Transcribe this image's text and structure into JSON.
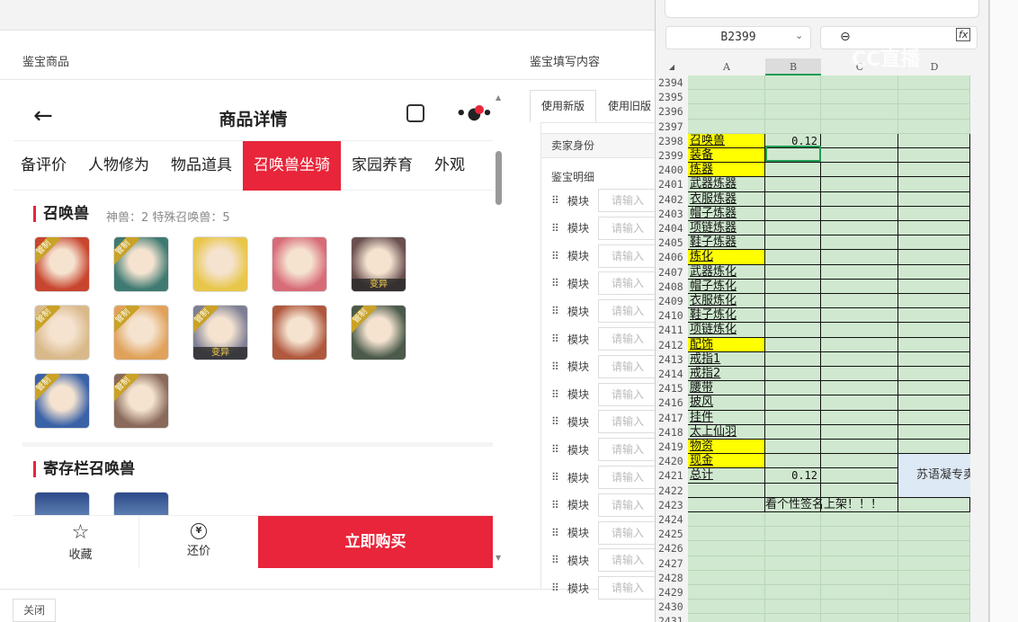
{
  "dialog": {
    "left_title": "鉴宝商品",
    "right_title": "鉴宝填写内容",
    "close_label": "关闭"
  },
  "phone": {
    "title": "商品详情",
    "tabs": [
      "备评价",
      "人物修为",
      "物品道具",
      "召唤兽坐骑",
      "家园养育",
      "外观"
    ],
    "active_tab": "召唤兽坐骑",
    "section1": {
      "title": "召唤兽",
      "subtitle": "神兽：2  特殊召唤兽：5"
    },
    "pets": [
      {
        "badge": "管制",
        "variant": "",
        "color": "#c8452f"
      },
      {
        "badge": "管制",
        "variant": "",
        "color": "#3f7a72"
      },
      {
        "badge": "",
        "variant": "",
        "color": "#e8c64a"
      },
      {
        "badge": "",
        "variant": "",
        "color": "#d86b78"
      },
      {
        "badge": "",
        "variant": "变异",
        "color": "#6a5050"
      },
      {
        "badge": "管制",
        "variant": "",
        "color": "#d9b98a"
      },
      {
        "badge": "管制",
        "variant": "",
        "color": "#e0a25a"
      },
      {
        "badge": "管制",
        "variant": "变异",
        "color": "#7d7f95"
      },
      {
        "badge": "",
        "variant": "",
        "color": "#b0583e"
      },
      {
        "badge": "管制",
        "variant": "",
        "color": "#4b5a4a"
      },
      {
        "badge": "管制",
        "variant": "",
        "color": "#3a62a8"
      },
      {
        "badge": "管制",
        "variant": "",
        "color": "#8a6a5a"
      }
    ],
    "section2": {
      "title": "寄存栏召唤兽"
    },
    "bottom": {
      "favorite": "收藏",
      "bargain": "还价",
      "buy": "立即购买"
    }
  },
  "form": {
    "tabs": [
      "使用新版",
      "使用旧版"
    ],
    "seller": "卖家身份",
    "detail": "鉴宝明细",
    "module_label": "模块",
    "placeholder": "请输入",
    "module_count": 15
  },
  "sheet": {
    "name_box": "B2399",
    "columns": [
      "A",
      "B",
      "C",
      "D"
    ],
    "watermark": "CC直播",
    "rows": [
      {
        "n": "2394"
      },
      {
        "n": "2395"
      },
      {
        "n": "2396"
      },
      {
        "n": "2397"
      },
      {
        "n": "2398",
        "a": "召唤兽",
        "y": true,
        "b": "0.12"
      },
      {
        "n": "2399",
        "a": "装备",
        "y": true
      },
      {
        "n": "2400",
        "a": "炼器",
        "y": true
      },
      {
        "n": "2401",
        "a": "武器炼器"
      },
      {
        "n": "2402",
        "a": "衣服炼器"
      },
      {
        "n": "2403",
        "a": "帽子炼器"
      },
      {
        "n": "2404",
        "a": "项链炼器"
      },
      {
        "n": "2405",
        "a": "鞋子炼器"
      },
      {
        "n": "2406",
        "a": "炼化",
        "y": true
      },
      {
        "n": "2407",
        "a": "武器炼化"
      },
      {
        "n": "2408",
        "a": "帽子炼化"
      },
      {
        "n": "2409",
        "a": "衣服炼化"
      },
      {
        "n": "2410",
        "a": "鞋子炼化"
      },
      {
        "n": "2411",
        "a": "项链炼化"
      },
      {
        "n": "2412",
        "a": "配饰",
        "y": true
      },
      {
        "n": "2413",
        "a": "戒指1"
      },
      {
        "n": "2414",
        "a": "戒指2"
      },
      {
        "n": "2415",
        "a": "腰带"
      },
      {
        "n": "2416",
        "a": "披风"
      },
      {
        "n": "2417",
        "a": "挂件"
      },
      {
        "n": "2418",
        "a": "太上仙羽"
      },
      {
        "n": "2419",
        "a": "物资",
        "y": true
      },
      {
        "n": "2420",
        "a": "现金",
        "y": true
      },
      {
        "n": "2421",
        "a": "总计",
        "b": "0.12"
      },
      {
        "n": "2422"
      },
      {
        "n": "2423",
        "b": "看个性签名上架！！！"
      },
      {
        "n": "2424"
      },
      {
        "n": "2425"
      },
      {
        "n": "2426"
      },
      {
        "n": "2427"
      },
      {
        "n": "2428"
      },
      {
        "n": "2429"
      },
      {
        "n": "2430"
      },
      {
        "n": "2431"
      }
    ],
    "merged_cell": "苏语凝专卖"
  }
}
